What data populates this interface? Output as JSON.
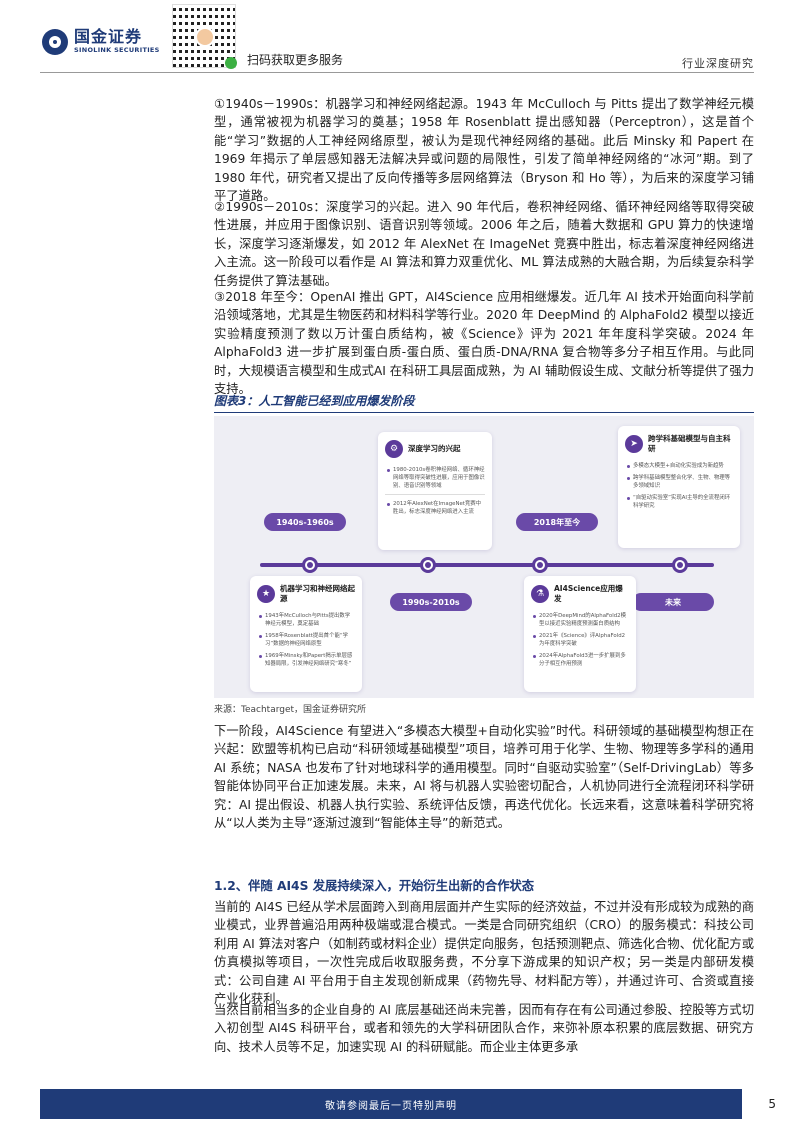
{
  "header": {
    "logo_cn": "国金证券",
    "logo_en": "SINOLINK SECURITIES",
    "scan_text": "扫码获取更多服务",
    "doc_type": "行业深度研究"
  },
  "paragraphs": {
    "p1": "①1940s－1990s：机器学习和神经网络起源。1943 年 McCulloch 与 Pitts 提出了数学神经元模型，通常被视为机器学习的奠基；1958 年 Rosenblatt 提出感知器（Perceptron），这是首个能“学习”数据的人工神经网络原型，被认为是现代神经网络的基础。此后 Minsky 和 Papert 在 1969 年揭示了单层感知器无法解决异或问题的局限性，引发了简单神经网络的“冰河”期。到了 1980 年代，研究者又提出了反向传播等多层网络算法（Bryson 和 Ho 等），为后来的深度学习铺平了道路。",
    "p2": "②1990s－2010s：深度学习的兴起。进入 90 年代后，卷积神经网络、循环神经网络等取得突破性进展，并应用于图像识别、语音识别等领域。2006 年之后，随着大数据和 GPU 算力的快速增长，深度学习逐渐爆发，如 2012 年 AlexNet 在 ImageNet 竞赛中胜出，标志着深度神经网络进入主流。这一阶段可以看作是 AI 算法和算力双重优化、ML 算法成熟的大融合期，为后续复杂科学任务提供了算法基础。",
    "p3": "③2018 年至今：OpenAI 推出 GPT，AI4Science 应用相继爆发。近几年 AI 技术开始面向科学前沿领域落地，尤其是生物医药和材料科学等行业。2020 年 DeepMind 的 AlphaFold2 模型以接近实验精度预测了数以万计蛋白质结构，被《Science》评为 2021 年年度科学突破。2024 年 AlphaFold3 进一步扩展到蛋白质-蛋白质、蛋白质-DNA/RNA 复合物等多分子相互作用。与此同时，大规模语言模型和生成式AI 在科研工具层面成熟，为 AI 辅助假设生成、文献分析等提供了强力支持。",
    "p4": "下一阶段，AI4Science 有望进入“多模态大模型+自动化实验”时代。科研领域的基础模型构想正在兴起：欧盟等机构已启动“科研领域基础模型”项目，培养可用于化学、生物、物理等多学科的通用 AI 系统；NASA 也发布了针对地球科学的通用模型。同时“自驱动实验室”（Self-DrivingLab）等多智能体协同平台正加速发展。未来，AI 将与机器人实验密切配合，人机协同进行全流程闭环科学研究：AI 提出假设、机器人执行实验、系统评估反馈，再迭代优化。长远来看，这意味着科学研究将从“以人类为主导”逐渐过渡到“智能体主导”的新范式。",
    "p5": "当前的 AI4S 已经从学术层面跨入到商用层面并产生实际的经济效益，不过并没有形成较为成熟的商业模式，业界普遍沿用两种极端或混合模式。一类是合同研究组织（CRO）的服务模式：科技公司利用 AI 算法对客户（如制药或材料企业）提供定向服务，包括预测靶点、筛选化合物、优化配方或仿真模拟等项目，一次性完成后收取服务费，不分享下游成果的知识产权；另一类是内部研发模式：公司自建 AI 平台用于自主发现创新成果（药物先导、材料配方等），并通过许可、合资或直接产业化获利。",
    "p6": "当然目前相当多的企业自身的 AI 底层基础还尚未完善，因而有存在有公司通过参股、控股等方式切入初创型 AI4S 科研平台，或者和领先的大学科研团队合作，来弥补原本积累的底层数据、研究方向、技术人员等不足，加速实现 AI 的科研赋能。而企业主体更多承"
  },
  "figure": {
    "title": "图表3：人工智能已经到应用爆发阶段",
    "source": "来源：Teachtarget，国金证券研究所",
    "pills": [
      "1940s-1960s",
      "1990s-2010s",
      "2018年至今",
      "未来"
    ],
    "cards": {
      "c1": {
        "title": "机器学习和神经网络起源",
        "icon": "lightbulb-icon",
        "bullets": [
          "1943年McCulloch与Pitts提出数学神经元模型，奠定基础",
          "1958年Rosenblatt提出首个能“学习”数据的神经网络原型",
          "1969年Minsky和Papert揭示单层感知器局限，引发神经网络研究“寒冬”"
        ]
      },
      "c2": {
        "title": "深度学习的兴起",
        "icon": "gear-icon",
        "bullets": [
          "1980-2010s卷积神经网络、循环神经网络等取得突破性进展，应用于图像识别、语音识别等领域",
          "2012年AlexNet在ImageNet竞赛中胜出，标志深度神经网络进入主流"
        ]
      },
      "c3": {
        "title": "AI4Science应用爆发",
        "icon": "flask-icon",
        "bullets": [
          "2020年DeepMind的AlphaFold2模型以接近实验精度预测蛋白质结构",
          "2021年《Science》评AlphaFold2为年度科学突破",
          "2024年AlphaFold3进一步扩展到多分子相互作用预测"
        ]
      },
      "c4": {
        "title": "跨学科基础模型与自主科研",
        "icon": "rocket-icon",
        "bullets": [
          "多模态大模型+自动化实验成为新趋势",
          "跨学科基础模型整合化学、生物、物理等多领域知识",
          "“自驱动实验室”实现AI主导的全流程闭环科学研究"
        ]
      }
    }
  },
  "section": {
    "title": "1.2、伴随 AI4S 发展持续深入，开始衍生出新的合作状态"
  },
  "footer": {
    "disclaimer": "敬请参阅最后一页特别声明",
    "page": "5"
  },
  "colors": {
    "brand": "#1f3b78",
    "timeline": "#5b3a9a",
    "pill": "#6a4aa8",
    "figure_bg": "#eeeef4"
  }
}
